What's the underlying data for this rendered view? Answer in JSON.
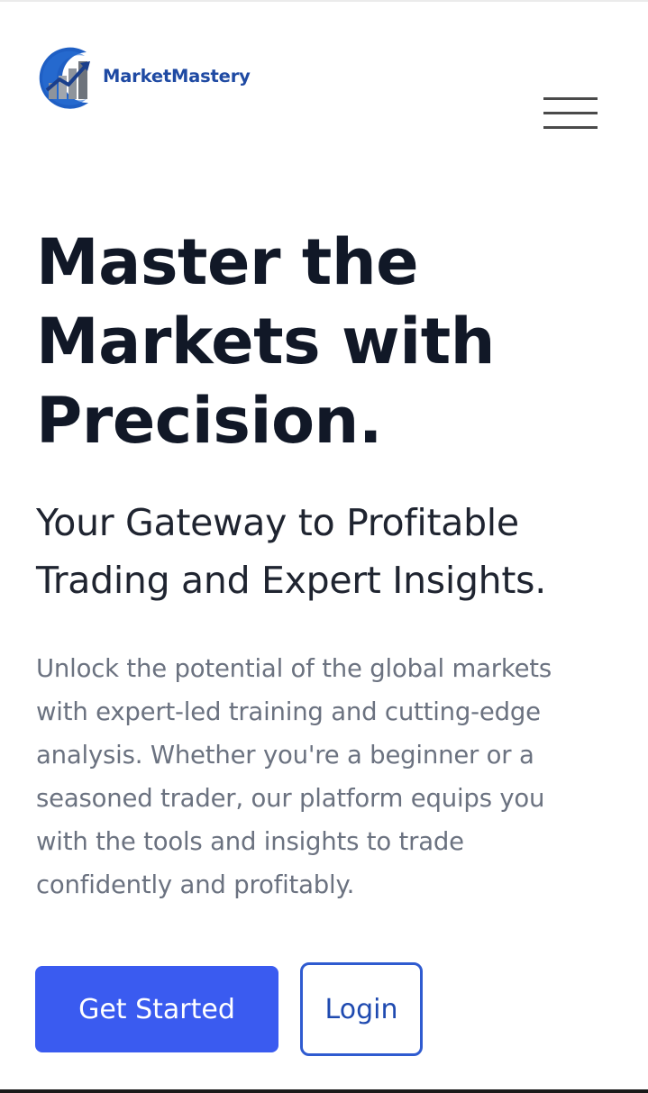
{
  "brand": {
    "name": "MarketMastery",
    "logo_icon": "chart-logo-icon",
    "primary_color": "#1f4aa3",
    "accent_color": "#3a5bf0"
  },
  "header": {
    "menu_icon": "hamburger-menu-icon"
  },
  "hero": {
    "title_lines": [
      "Master the",
      "Markets with",
      "Precision."
    ],
    "subtitle_lines": [
      "Your Gateway to Profitable",
      "Trading and Expert Insights."
    ],
    "description_lines": [
      "Unlock the potential of the global markets",
      "with expert-led training and cutting-edge",
      "analysis. Whether you're a beginner or a",
      "seasoned trader, our platform equips you",
      "with the tools and insights to trade",
      "confidently and profitably."
    ]
  },
  "actions": {
    "get_started_label": "Get Started",
    "login_label": "Login"
  }
}
